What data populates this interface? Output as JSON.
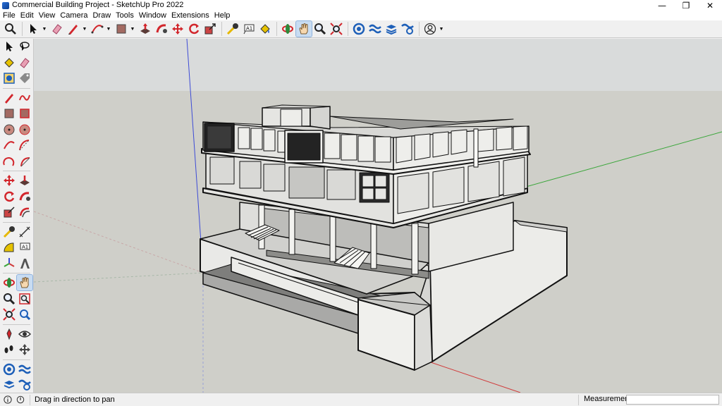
{
  "window": {
    "title": "Commercial Building Project - SketchUp Pro 2022",
    "controls": [
      "—",
      "❐",
      "✕"
    ]
  },
  "menu": [
    "File",
    "Edit",
    "View",
    "Camera",
    "Draw",
    "Tools",
    "Window",
    "Extensions",
    "Help"
  ],
  "toolbar": {
    "icons": [
      "search-icon",
      "select-arrow-icon",
      "eraser-icon",
      "pencil-line-icon",
      "arc-icon",
      "shape-rectangle-icon",
      "push-pull-icon",
      "follow-me-icon",
      "move-icon",
      "rotate-icon",
      "scale-icon",
      "tape-measure-icon",
      "text-label-icon",
      "paint-bucket-icon",
      "orbit-icon",
      "pan-hand-icon",
      "zoom-icon",
      "zoom-extents-icon",
      "components-icon",
      "layers-icon",
      "styles-icon",
      "scenes-icon",
      "account-icon"
    ],
    "active": "pan-hand-icon"
  },
  "left_toolbar": {
    "active": "pan-hand-icon"
  },
  "colors": {
    "sky": "#d9dbdb",
    "ground": "#cfcfc9",
    "axis_red": "#d03a3a",
    "axis_green": "#3aa63a",
    "axis_blue": "#3d4bd6",
    "active_bg": "#c8dcf2",
    "accent_red": "#d2262c"
  },
  "status": {
    "hint": "Drag in direction to pan",
    "measurements_label": "Measurements",
    "measurements_value": ""
  }
}
